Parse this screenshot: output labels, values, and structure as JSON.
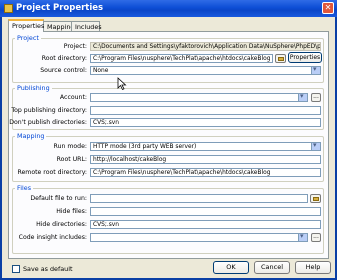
{
  "window": {
    "title": "Project Properties",
    "close_glyph": "✕"
  },
  "tabs": [
    {
      "label": "Properties"
    },
    {
      "label": "Mapping"
    },
    {
      "label": "Includes"
    }
  ],
  "groups": {
    "project": {
      "title": "Project",
      "project_label": "Project:",
      "project_value": "C:\\Documents and Settings\\yfaktorovich\\Application Data\\NuSphere\\PhpED\\projects\\CakePh",
      "root_label": "Root directory:",
      "root_value": "C:\\Program Files\\nusphere\\TechPlat\\apache\\htdocs\\cakeBlog",
      "properties_button": "Properties",
      "source_label": "Source control:",
      "source_value": "None"
    },
    "publishing": {
      "title": "Publishing",
      "account_label": "Account:",
      "account_value": "",
      "top_label": "Top publishing directory:",
      "top_value": "",
      "dont_label": "Don't publish directories:",
      "dont_value": "CVS;.svn"
    },
    "mapping": {
      "title": "Mapping",
      "run_label": "Run mode:",
      "run_value": "HTTP mode (3rd party WEB server)",
      "url_label": "Root URL:",
      "url_value": "http://localhost/cakeBlog",
      "remote_label": "Remote root directory:",
      "remote_value": "C:\\Program Files\\nusphere\\TechPlat\\apache\\htdocs\\cakeBlog"
    },
    "files": {
      "title": "Files",
      "default_label": "Default file to run:",
      "default_value": "",
      "hide_files_label": "Hide files:",
      "hide_files_value": "",
      "hide_dirs_label": "Hide directories:",
      "hide_dirs_value": "CVS;.svn",
      "insight_label": "Code insight includes:",
      "insight_value": ""
    }
  },
  "ellipsis": "...",
  "footer": {
    "save_default": "Save as default",
    "ok": "OK",
    "cancel": "Cancel",
    "help": "Help"
  }
}
